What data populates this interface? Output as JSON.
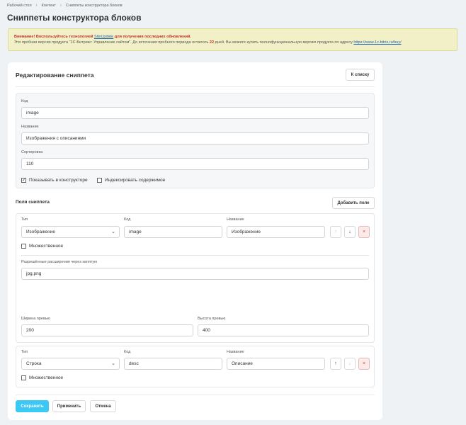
{
  "breadcrumb": [
    "Рабочий стол",
    "Контент",
    "Сниппеты конструктора блоков"
  ],
  "breadcrumb_sep": "›",
  "page_title": "Сниппеты конструктора блоков",
  "notice": {
    "warn_prefix": "Внимание! Воспользуйтесь технологией",
    "warn_link": "SiteUpdate",
    "warn_suffix": "для получения последних обновлений.",
    "line2_prefix": "Это пробная версия продукта \"1С-Битрикс: Управление сайтом\". До истечения пробного периода осталось",
    "days": "22",
    "line2_middle": "дней. Вы можете купить полнофункциональную версию продукта по адресу",
    "line2_link": "https://www.1c-bitrix.ru/buy/"
  },
  "card": {
    "title": "Редактирование сниппета",
    "back_button": "К списку"
  },
  "main_fields": {
    "code_label": "Код",
    "code_value": "image",
    "name_label": "Название",
    "name_value": "Изображения с описаниями",
    "sort_label": "Сортировка",
    "sort_value": "110",
    "show_in_builder": "Показывать в конструкторе",
    "show_in_builder_checked": true,
    "index_content": "Индексировать содержимое",
    "index_content_checked": false
  },
  "fields_section": {
    "title": "Поля сниппета",
    "add_button": "Добавить поле",
    "col_type": "Тип",
    "col_code": "Код",
    "col_name": "Название",
    "multiple_label": "Множественное",
    "items": [
      {
        "type": "Изображение",
        "code": "image",
        "name": "Изображение",
        "multiple": false,
        "ext_label": "Разрешённые расширения через запятую",
        "ext_value": "jpg,png",
        "width_label": "Ширина превью",
        "width_value": "200",
        "height_label": "Высота превью",
        "height_value": "400"
      },
      {
        "type": "Строка",
        "code": "desc",
        "name": "Описание",
        "multiple": false
      }
    ]
  },
  "footer": {
    "save": "Сохранить",
    "apply": "Применить",
    "cancel": "Отмена"
  },
  "icons": {
    "up": "↑",
    "down": "↓",
    "delete": "×",
    "caret": "⌄",
    "star": "☆",
    "check": "✓"
  },
  "colors": {
    "accent": "#3bc8f5",
    "notice_bg": "#f1f0c6",
    "warn": "#c3302d",
    "link": "#2067b0"
  }
}
